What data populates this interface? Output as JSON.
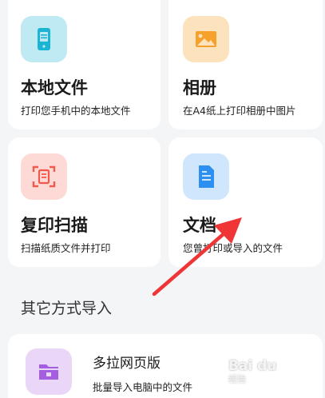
{
  "cards": [
    {
      "title": "本地文件",
      "subtitle": "打印您手机中的本地文件",
      "icon": "phone-icon",
      "icon_bg": "#bfeaf3",
      "icon_color": "#1bb5d3"
    },
    {
      "title": "相册",
      "subtitle": "在A4纸上打印相册中图片",
      "icon": "image-icon",
      "icon_bg": "#fde3bd",
      "icon_color": "#f6a12b"
    },
    {
      "title": "复印扫描",
      "subtitle": "扫描纸质文件并打印",
      "icon": "scan-icon",
      "icon_bg": "#fddad6",
      "icon_color": "#ef5a4a"
    },
    {
      "title": "文档",
      "subtitle": "您曾打印或导入的文件",
      "icon": "document-icon",
      "icon_bg": "#cfe6fc",
      "icon_color": "#2d8ff0"
    }
  ],
  "other": {
    "section_title": "其它方式导入",
    "items": [
      {
        "title": "多拉网页版",
        "subtitle": "批量导入电脑中的文件",
        "icon": "folder-icon",
        "icon_bg": "#ead7f8",
        "icon_color": "#a45ee0"
      }
    ]
  },
  "annotation": {
    "arrow_color": "#ef3535"
  },
  "watermark": {
    "text": "Bai du",
    "sub": "经验"
  }
}
